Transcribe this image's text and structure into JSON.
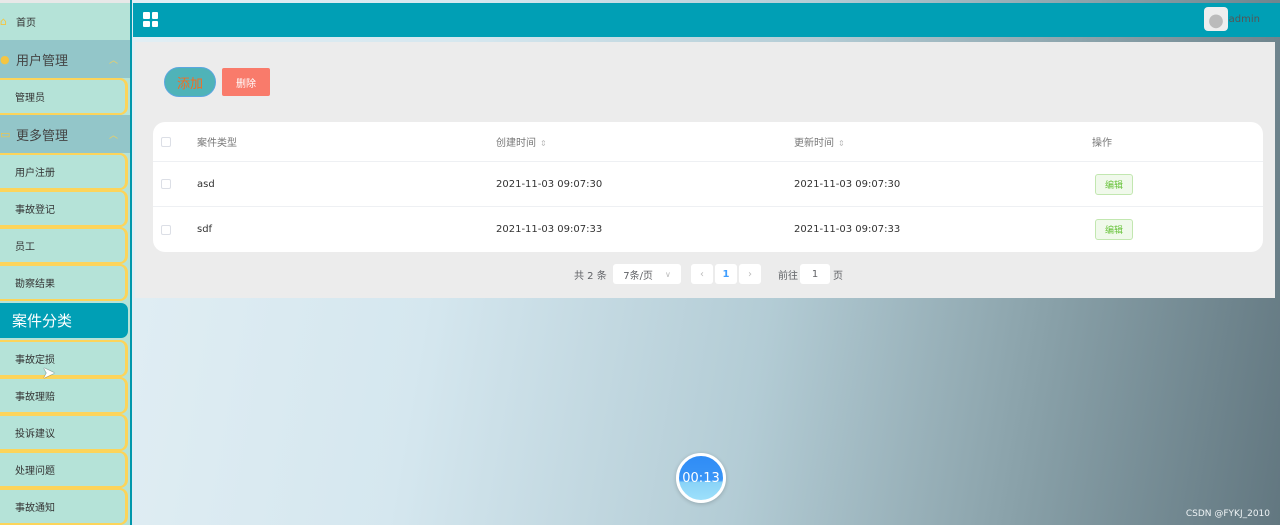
{
  "sidebar": {
    "home": "首页",
    "group1": "用户管理",
    "group1_items": [
      "管理员"
    ],
    "group2": "更多管理",
    "items_before": [
      "用户注册",
      "事故登记",
      "员工",
      "勘察结果"
    ],
    "active": "案件分类",
    "items_after": [
      "事故定损",
      "事故理赔",
      "投诉建议",
      "处理问题",
      "事故通知"
    ]
  },
  "header": {
    "user": "admin"
  },
  "toolbar": {
    "add": "添加",
    "delete": "删除"
  },
  "table": {
    "columns": [
      "案件类型",
      "创建时间",
      "更新时间",
      "操作"
    ],
    "sort_icon": "⇕",
    "rows": [
      {
        "type": "asd",
        "created": "2021-11-03 09:07:30",
        "updated": "2021-11-03 09:07:30",
        "action": "编辑"
      },
      {
        "type": "sdf",
        "created": "2021-11-03 09:07:33",
        "updated": "2021-11-03 09:07:33",
        "action": "编辑"
      }
    ]
  },
  "pagination": {
    "total": "共 2 条",
    "page_size": "7条/页",
    "current": "1",
    "goto_label": "前往",
    "goto_value": "1",
    "page_suffix": "页"
  },
  "timer": "00:13",
  "watermark": "CSDN @FYKJ_2010",
  "colors": {
    "primary": "#009fb5",
    "sidebar": "#b5e3d8",
    "accent": "#fcd45a"
  }
}
